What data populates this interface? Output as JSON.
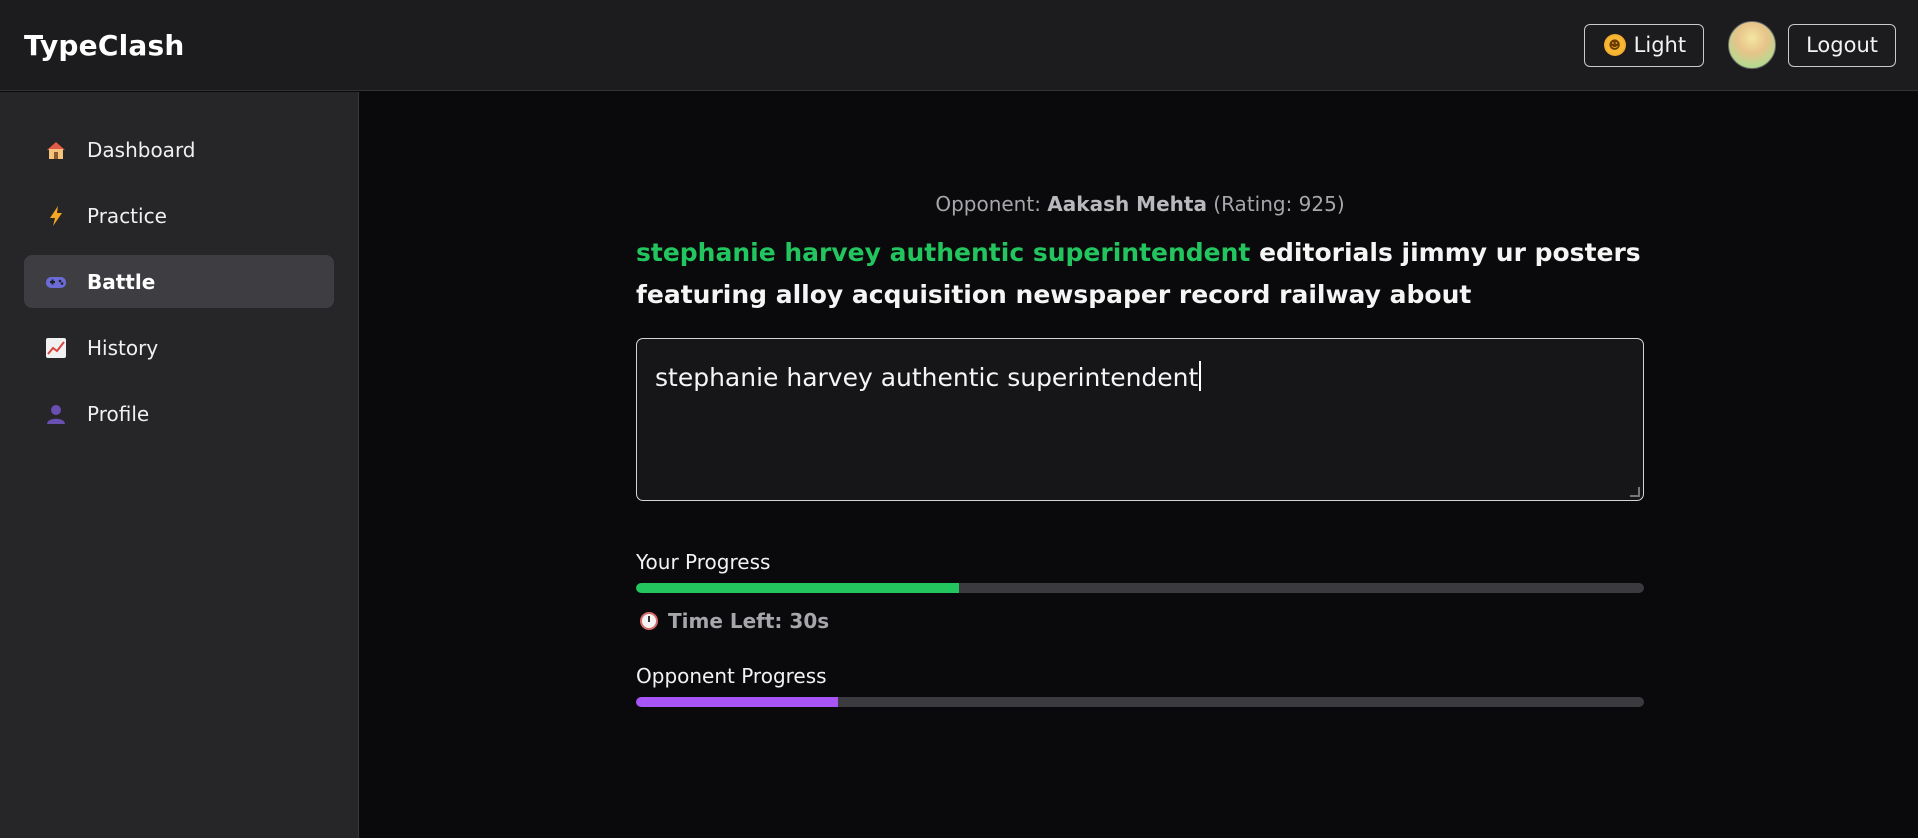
{
  "app": {
    "title": "TypeClash"
  },
  "header": {
    "theme_label": "Light",
    "theme_icon": "sun-icon",
    "avatar_icon": "avatar",
    "logout_label": "Logout"
  },
  "sidebar": {
    "items": [
      {
        "label": "Dashboard",
        "icon": "house-icon",
        "active": false
      },
      {
        "label": "Practice",
        "icon": "lightning-icon",
        "active": false
      },
      {
        "label": "Battle",
        "icon": "gamepad-icon",
        "active": true
      },
      {
        "label": "History",
        "icon": "chart-icon",
        "active": false
      },
      {
        "label": "Profile",
        "icon": "user-icon",
        "active": false
      }
    ]
  },
  "battle": {
    "opponent_prefix": "Opponent: ",
    "opponent_name": "Aakash Mehta",
    "opponent_rating": "(Rating: 925)",
    "passage_typed": "stephanie harvey authentic superintendent",
    "passage_rest": " editorials jimmy ur posters featuring alloy acquisition newspaper record railway about",
    "input_value": "stephanie harvey authentic superintendent",
    "your_progress_label": "Your Progress",
    "your_progress": 0.32,
    "your_progress_color": "#22c55e",
    "time_left_label": "Time Left: 30s",
    "opponent_progress_label": "Opponent Progress",
    "opponent_progress": 0.2,
    "opponent_progress_color": "#a855f7"
  }
}
